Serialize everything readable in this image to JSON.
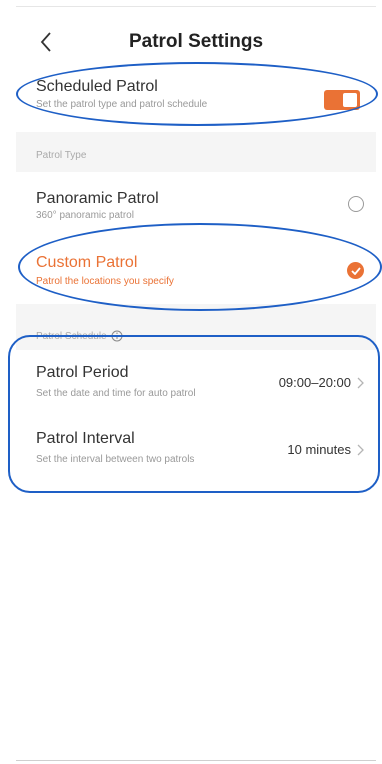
{
  "header": {
    "title": "Patrol Settings"
  },
  "scheduled": {
    "title": "Scheduled Patrol",
    "subtitle": "Set the patrol type and patrol schedule",
    "enabled": true
  },
  "patrol_type": {
    "label": "Patrol Type",
    "options": [
      {
        "title": "Panoramic Patrol",
        "subtitle": "360° panoramic patrol",
        "selected": false
      },
      {
        "title": "Custom Patrol",
        "subtitle": "Patrol the locations you specify",
        "selected": true
      }
    ]
  },
  "schedule": {
    "label": "Patrol Schedule",
    "period": {
      "title": "Patrol Period",
      "subtitle": "Set the date and time for auto patrol",
      "value": "09:00–20:00"
    },
    "interval": {
      "title": "Patrol Interval",
      "subtitle": "Set the interval between two patrols",
      "value": "10 minutes"
    }
  },
  "colors": {
    "accent": "#ea7235",
    "annotation": "#1e5fc6"
  }
}
